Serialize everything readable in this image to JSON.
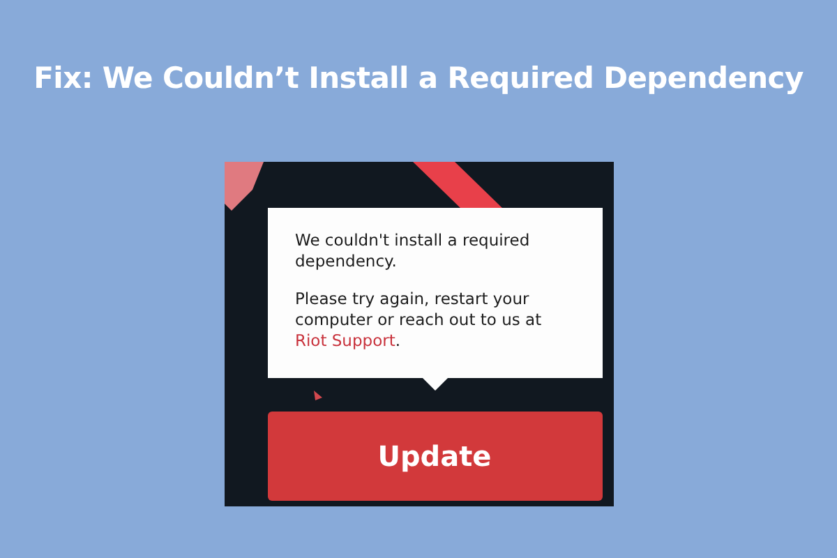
{
  "headline": "Fix: We Couldn’t Install a Required Dependency",
  "dialog": {
    "message": "We couldn't install a required dependency.",
    "help": {
      "before": "Please try again, restart your computer or reach out to us at ",
      "link": "Riot Support",
      "after": "."
    },
    "button": "Update"
  }
}
